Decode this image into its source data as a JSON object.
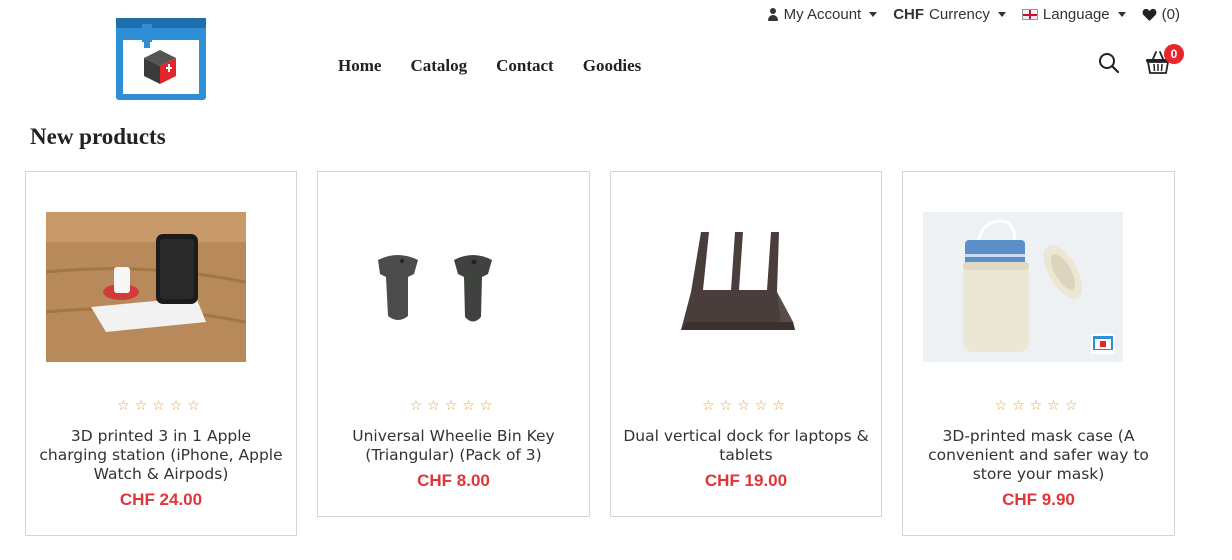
{
  "header": {
    "account_label": "My Account",
    "currency_code": "CHF",
    "currency_label": "Currency",
    "language_label": "Language",
    "wishlist_count": "(0)",
    "cart_count": "0"
  },
  "nav": {
    "items": [
      "Home",
      "Catalog",
      "Contact",
      "Goodies"
    ]
  },
  "section": {
    "title": "New products"
  },
  "products": [
    {
      "name": "3D printed 3 in 1 Apple charging station (iPhone, Apple Watch & Airpods)",
      "price": "CHF 24.00",
      "stars": "☆☆☆☆☆"
    },
    {
      "name": "Universal Wheelie Bin Key (Triangular) (Pack of 3)",
      "price": "CHF 8.00",
      "stars": "☆☆☆☆☆"
    },
    {
      "name": "Dual vertical dock for laptops & tablets",
      "price": "CHF 19.00",
      "stars": "☆☆☆☆☆"
    },
    {
      "name": "3D-printed mask case (A convenient and safer way to store your mask)",
      "price": "CHF 9.90",
      "stars": "☆☆☆☆☆"
    }
  ],
  "colors": {
    "accent_red": "#e0353a",
    "star_orange": "#e9a23b",
    "logo_blue": "#2e8fd6"
  }
}
